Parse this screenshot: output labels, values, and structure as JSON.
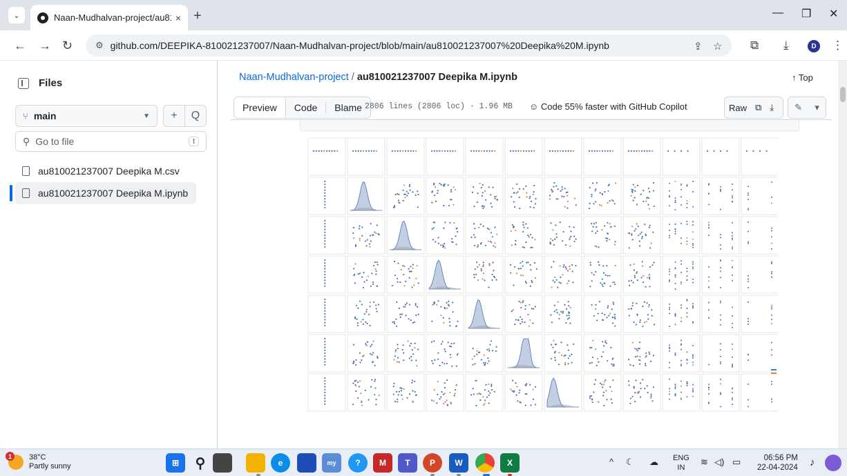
{
  "browser": {
    "tab_title": "Naan-Mudhalvan-project/au81",
    "tab_close": "×",
    "new_tab": "+",
    "url": "github.com/DEEPIKA-810021237007/Naan-Mudhalvan-project/blob/main/au810021237007%20Deepika%20M.ipynb",
    "profile_initial": "D"
  },
  "sidebar": {
    "title": "Files",
    "branch": "main",
    "add_label": "+",
    "search_label": "Q",
    "goto_placeholder": "Go to file",
    "goto_shortcut": "t",
    "files": [
      {
        "name": "au810021237007 Deepika M.csv"
      },
      {
        "name": "au810021237007 Deepika M.ipynb"
      }
    ]
  },
  "header": {
    "repo": "Naan-Mudhalvan-project",
    "separator": "/",
    "file": "au810021237007 Deepika M.ipynb",
    "top_link": "↑ Top"
  },
  "filebar": {
    "preview": "Preview",
    "code": "Code",
    "blame": "Blame",
    "info": "2806 lines (2806 loc) · 1.96 MB",
    "copilot": "Code 55% faster with GitHub Copilot",
    "raw": "Raw"
  },
  "plot": {
    "grid_rows": 8,
    "grid_cols": 12,
    "colors": {
      "series_a": "#4c72b0",
      "series_b": "#dd8452"
    },
    "legend_label": "[illegible legend title]"
  },
  "taskbar": {
    "temperature": "38°C",
    "condition": "Partly sunny",
    "weather_badge": "1",
    "lang_top": "ENG",
    "lang_bottom": "IN",
    "time": "06:56 PM",
    "date": "22-04-2024"
  }
}
